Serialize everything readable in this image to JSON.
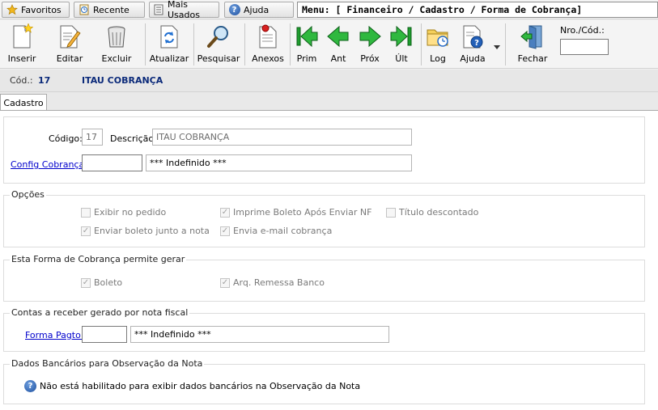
{
  "topbar": {
    "favoritos": "Favoritos",
    "recente": "Recente",
    "mais_usados": "Mais Usados",
    "ajuda": "Ajuda",
    "menu_path": "Menu: [ Financeiro / Cadastro / Forma de Cobrança]"
  },
  "toolbar": {
    "inserir": "Inserir",
    "editar": "Editar",
    "excluir": "Excluir",
    "atualizar": "Atualizar",
    "pesquisar": "Pesquisar",
    "anexos": "Anexos",
    "prim": "Prim",
    "ant": "Ant",
    "prox": "Próx",
    "ult": "Últ",
    "log": "Log",
    "ajuda": "Ajuda",
    "fechar": "Fechar",
    "nro_cod_label": "Nro./Cód.:",
    "nro_cod_value": ""
  },
  "record": {
    "cod_label": "Cód.:",
    "cod_value": "17",
    "name": "ITAU COBRANÇA"
  },
  "tabs": {
    "cadastro": "Cadastro"
  },
  "main": {
    "codigo_label": "Código:",
    "codigo_value": "17",
    "descricao_label": "Descrição:",
    "descricao_value": "ITAU COBRANÇA",
    "config_cobranca_label": "Config Cobrança:",
    "config_cobranca_code": "",
    "config_cobranca_desc": "*** Indefinido ***"
  },
  "opcoes": {
    "title": "Opções",
    "exibir_pedido": {
      "label": "Exibir no pedido",
      "checked": false
    },
    "imprime_boleto": {
      "label": "Imprime Boleto Após Enviar NF",
      "checked": true
    },
    "titulo_descontado": {
      "label": "Título descontado",
      "checked": false
    },
    "enviar_boleto": {
      "label": "Enviar boleto junto a nota",
      "checked": true
    },
    "envia_email": {
      "label": "Envia e-mail cobrança",
      "checked": true
    }
  },
  "permite": {
    "title": "Esta Forma de Cobrança permite gerar",
    "boleto": {
      "label": "Boleto",
      "checked": true
    },
    "arq_remessa": {
      "label": "Arq. Remessa Banco",
      "checked": true
    }
  },
  "contas": {
    "title": "Contas a receber gerado por nota fiscal",
    "forma_pagto_label": "Forma Pagto:",
    "forma_pagto_code": "",
    "forma_pagto_desc": "*** Indefinido ***"
  },
  "bancarios": {
    "title": "Dados Bancários para Observação da Nota",
    "message": "Não está habilitado para exibir dados bancários na Observação da Nota"
  },
  "colors": {
    "record_text": "#0b2a7a",
    "link": "#0000cc",
    "nav_green": "#1e9e2e"
  }
}
